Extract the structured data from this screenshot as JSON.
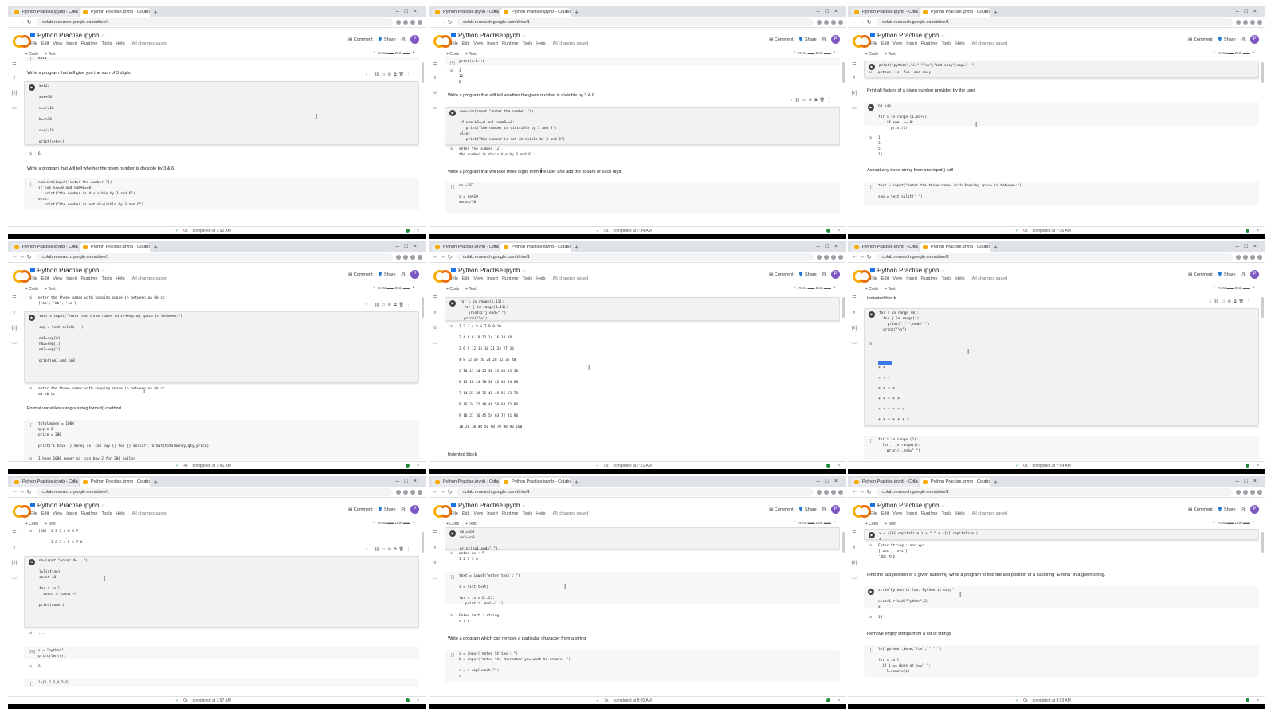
{
  "tabs": {
    "active_label": "Python Practise.ipynb - Colabor",
    "inactive_label": "Python Practise.ipynb - Colabor"
  },
  "window": {
    "url_prefix": "colab.research.google.com/drive/1"
  },
  "notebook": {
    "title": "Python Practise.ipynb",
    "menu": [
      "File",
      "Edit",
      "View",
      "Insert",
      "Runtime",
      "Tools",
      "Help"
    ],
    "saved": "All changes saved",
    "comment": "Comment",
    "share": "Share",
    "avatar": "P",
    "add_code": "+ Code",
    "add_text": "+ Text",
    "ram": "RAM ▬▬ Disk ▬▬",
    "editing": "✓"
  },
  "panes": [
    {
      "status": "completed at 7:32 AM",
      "time": "0s",
      "top_code": "8321",
      "text1": "Write a program that will give you the sum of 3 digits.",
      "code1": "x=123\n\na=x%10\n\nx=x//10\n\nb=x%10\n\nc=x//10\n\nprint(a+b+c)",
      "out1": "6",
      "text2": "Write a program that will tell whether the given number is divisible by 3 & 6.",
      "code2": "num=int(input(\"enter the number \"))\nif num %3==0 and num%6==0:\n   print(\"the number is divisible by 3 and 6\")\nelse:\n   print(\"the number is not divisible by 3 and 6\")"
    },
    {
      "status": "completed at 7:34 AM",
      "time": "0s",
      "top_code": "print(a+b+c)",
      "top_out": "3\n12\n6",
      "text1": "Write a program that will tell whether the given number is divisible by 3 & 6.",
      "code1": "num=int(input(\"enter the number \"))\n\nif num %3==0 and num%6==0:\n   print(\"the number is divisible by 3 and 6\")\nelse:\n   print(\"the number is not divisible by 3 and 6\")",
      "out1": "enter the number 12\nthe number is divisible by 3 and 6",
      "text2": "Write a program that will take three digits from the user and add the square of each digit.",
      "code2": "no =167\n\na = no%10\nx=no//10"
    },
    {
      "status": "completed at 7:36 AM",
      "time": "0s",
      "code0": "print(\"python\",\"is\",\"fun\",\"and easy\",sep=\"--\")",
      "out0": "python  is  fun  and easy",
      "text1": "Print all factors of a given number provided by the user",
      "code1": "no =15\n\nfor i in range (1,no+1):\n    if no%i == 0:\n      print(i)",
      "out1": "1\n3\n5\n15",
      "text2": "Accept any three string from one input() call",
      "code2": "text = input(\"enter the three names with keeping space in between:\")\n\nsep = text.split(' ')"
    },
    {
      "status": "completed at 7:41 AM",
      "time": "4s",
      "top_out": "enter the three names with keeping space in between:aa bb cc\n['aa', 'bb', 'cc']",
      "code1": "text = input(\"enter the three names with keeping space in between:\")\n\nsep = text.split(' ')\n\nnm1=sep[0]\nnm2=sep[1]\nnm3=sep[2]\n\nprint(nm1,nm2,nm3)",
      "out1": "enter the three names with keeping space in between:aa bb cc\naa bb cc",
      "text2": "Format variables using a string format() method.",
      "code2": "totalmoney = 1000\nqty = 2\nprice = 200\n\nprint(\"I have {} money so  can buy {} for {} dollar\".format(totalmoney,qty,price))",
      "out2": "I have 1000 money so  can buy 2 for 200 dollar"
    },
    {
      "status": "completed at 7:51 AM",
      "time": "0s",
      "code1": "for i in range(1,11):\n  for j in range(1,11):\n    print(i*j,end=\" \")\n  print(\"\\n\")",
      "out1": "1 2 3 4 5 6 7 8 9 10\n\n2 4 6 8 10 12 14 16 18 20\n\n3 6 9 12 15 18 21 24 27 30\n\n4 8 12 16 20 24 28 32 36 40\n\n5 10 15 20 25 30 35 40 45 50\n\n6 12 18 24 30 36 42 48 54 60\n\n7 14 21 28 35 42 49 56 63 70\n\n8 16 24 32 40 48 56 64 72 80\n\n9 18 27 36 45 54 63 72 81 90\n\n10 20 30 40 50 60 70 80 90 100",
      "text2": "Indented block"
    },
    {
      "status": "completed at 7:54 AM",
      "time": "0s",
      "text0": "Indented block",
      "code1": "for i in range (8):\n  for j in range(i):\n    print(\" * \",end=\" \")\n  print(\"\\n\")",
      "stars": "\n\n* *\n* * *\n* * * *\n* * * * *\n* * * * * *\n* * * * * * *",
      "code2": "for i in range (6):\n  for j in range(i):\n    print(j,end=\" \")"
    },
    {
      "status": "completed at 7:57 AM",
      "time": "0s",
      "top_out": "[20]  1 3 5 4 6 6 7\n\n      1 2 3 4 5 6 7 8",
      "code1": "no=input(\"enter No : \")\n\nl=list(no)\ncount =0\n\nfor i in l:\n  count = count +1\n\nprint(count)",
      "out1": "...",
      "code2": "s = \"python\"\nprint(len(s))",
      "out2": "6",
      "code3": "l=[1,2,3,4,5,6]"
    },
    {
      "status": "completed at 8:00 AM",
      "time": "7s",
      "code0": "no1=no2\nno2=no3\n\nprint(no1,end=\" \")",
      "out0": "enter no : 5\n1 2 3 5 8",
      "code1": "text = input(\"enter text : \")\n\ns = list(text)\n\nfor i in s[0::2]:\n   print(i, end =\" \")",
      "out1": "Enter text : string\ns r n",
      "text2": "Write a program which can remove a particular character from a string",
      "code2": "a = input(\"enter String : \")\nb = input(\"enter the character you want to remove: \")\n\nc = a.replace(b,\"\")\nc"
    },
    {
      "status": "completed at 8:03 AM",
      "time": "0s",
      "code0": "x = s[0].capitalize() + \" \" + s[1].capitalize()\nx",
      "out0": "Enter String : abc xyz\n['abc', 'xyz']\n'Abc Xyz'",
      "text1": "Find the last position of a given substring Write a program to find the last position of a substring \"Emma\" in a given string.",
      "code1": "str1=\"Python is fun. Python is easy\"\n\nx=str1.rfind(\"Python\",2)\nx",
      "out1": "15",
      "text2": "Remove empty strings from a list of strings",
      "code2": "l=[\"python\",None,\"fun\",\"\",\" \"]\n\nfor i in l:\n  if i == None or i==\" \":\n    l.remove(i)"
    }
  ]
}
